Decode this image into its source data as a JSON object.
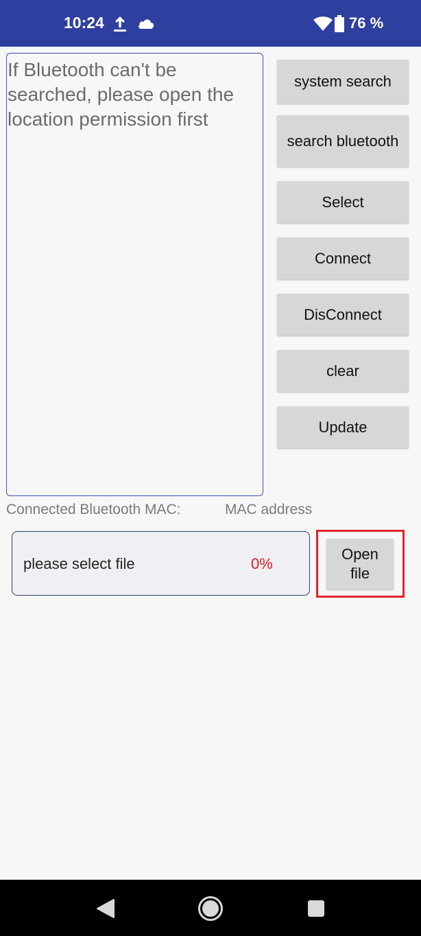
{
  "status_bar": {
    "time": "10:24",
    "battery": "76 %",
    "background": "#2f3f9f",
    "icons": [
      "upload-icon",
      "cloud-icon",
      "wifi-icon",
      "battery-icon"
    ]
  },
  "log": {
    "text": "If Bluetooth can't be searched, please open the location permission first"
  },
  "buttons": {
    "system_search": "system search",
    "search_bluetooth": "search bluetooth",
    "select": "Select",
    "connect": "Connect",
    "disconnect": "DisConnect",
    "clear": "clear",
    "update": "Update"
  },
  "mac": {
    "label": "Connected Bluetooth MAC:",
    "value": "MAC address"
  },
  "file": {
    "label": "please select file",
    "progress": "0%",
    "progress_color": "#e02020",
    "open_button": "Open file",
    "highlight_color": "#e3232d"
  },
  "nav_bar": {
    "icons": [
      "back-icon",
      "home-icon",
      "recents-icon"
    ]
  }
}
